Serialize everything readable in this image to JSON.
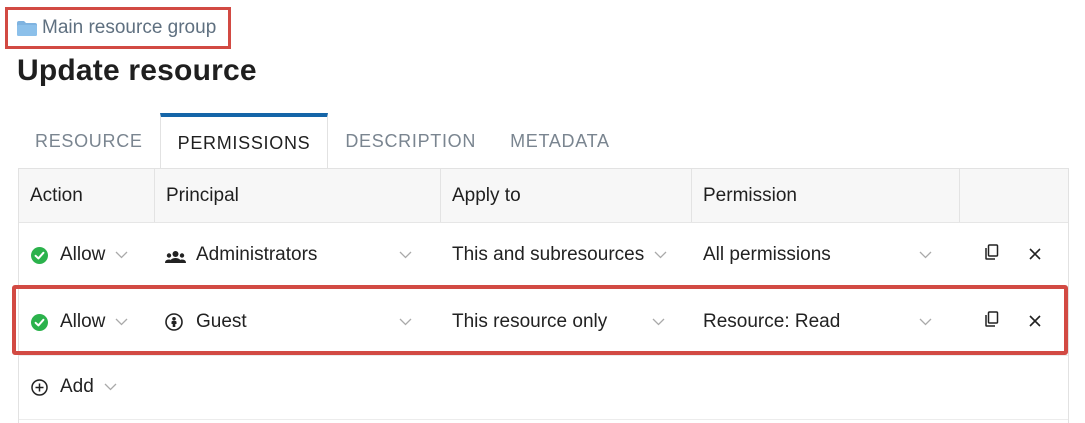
{
  "breadcrumb": {
    "label": "Main resource group",
    "icon": "folder-icon"
  },
  "page_title": "Update resource",
  "tabs": [
    {
      "label": "RESOURCE",
      "active": false
    },
    {
      "label": "PERMISSIONS",
      "active": true
    },
    {
      "label": "DESCRIPTION",
      "active": false
    },
    {
      "label": "METADATA",
      "active": false
    }
  ],
  "table": {
    "headers": [
      "Action",
      "Principal",
      "Apply to",
      "Permission"
    ],
    "rows": [
      {
        "action": "Allow",
        "principal": "Administrators",
        "principal_icon": "group-icon",
        "apply_to": "This and subresources",
        "permission": "All permissions"
      },
      {
        "action": "Allow",
        "principal": "Guest",
        "principal_icon": "guest-user-icon",
        "apply_to": "This resource only",
        "permission": "Resource: Read"
      }
    ],
    "add_label": "Add"
  },
  "colors": {
    "accent": "#1565a8",
    "allow": "#2bb24c",
    "highlight": "#d24a43"
  }
}
